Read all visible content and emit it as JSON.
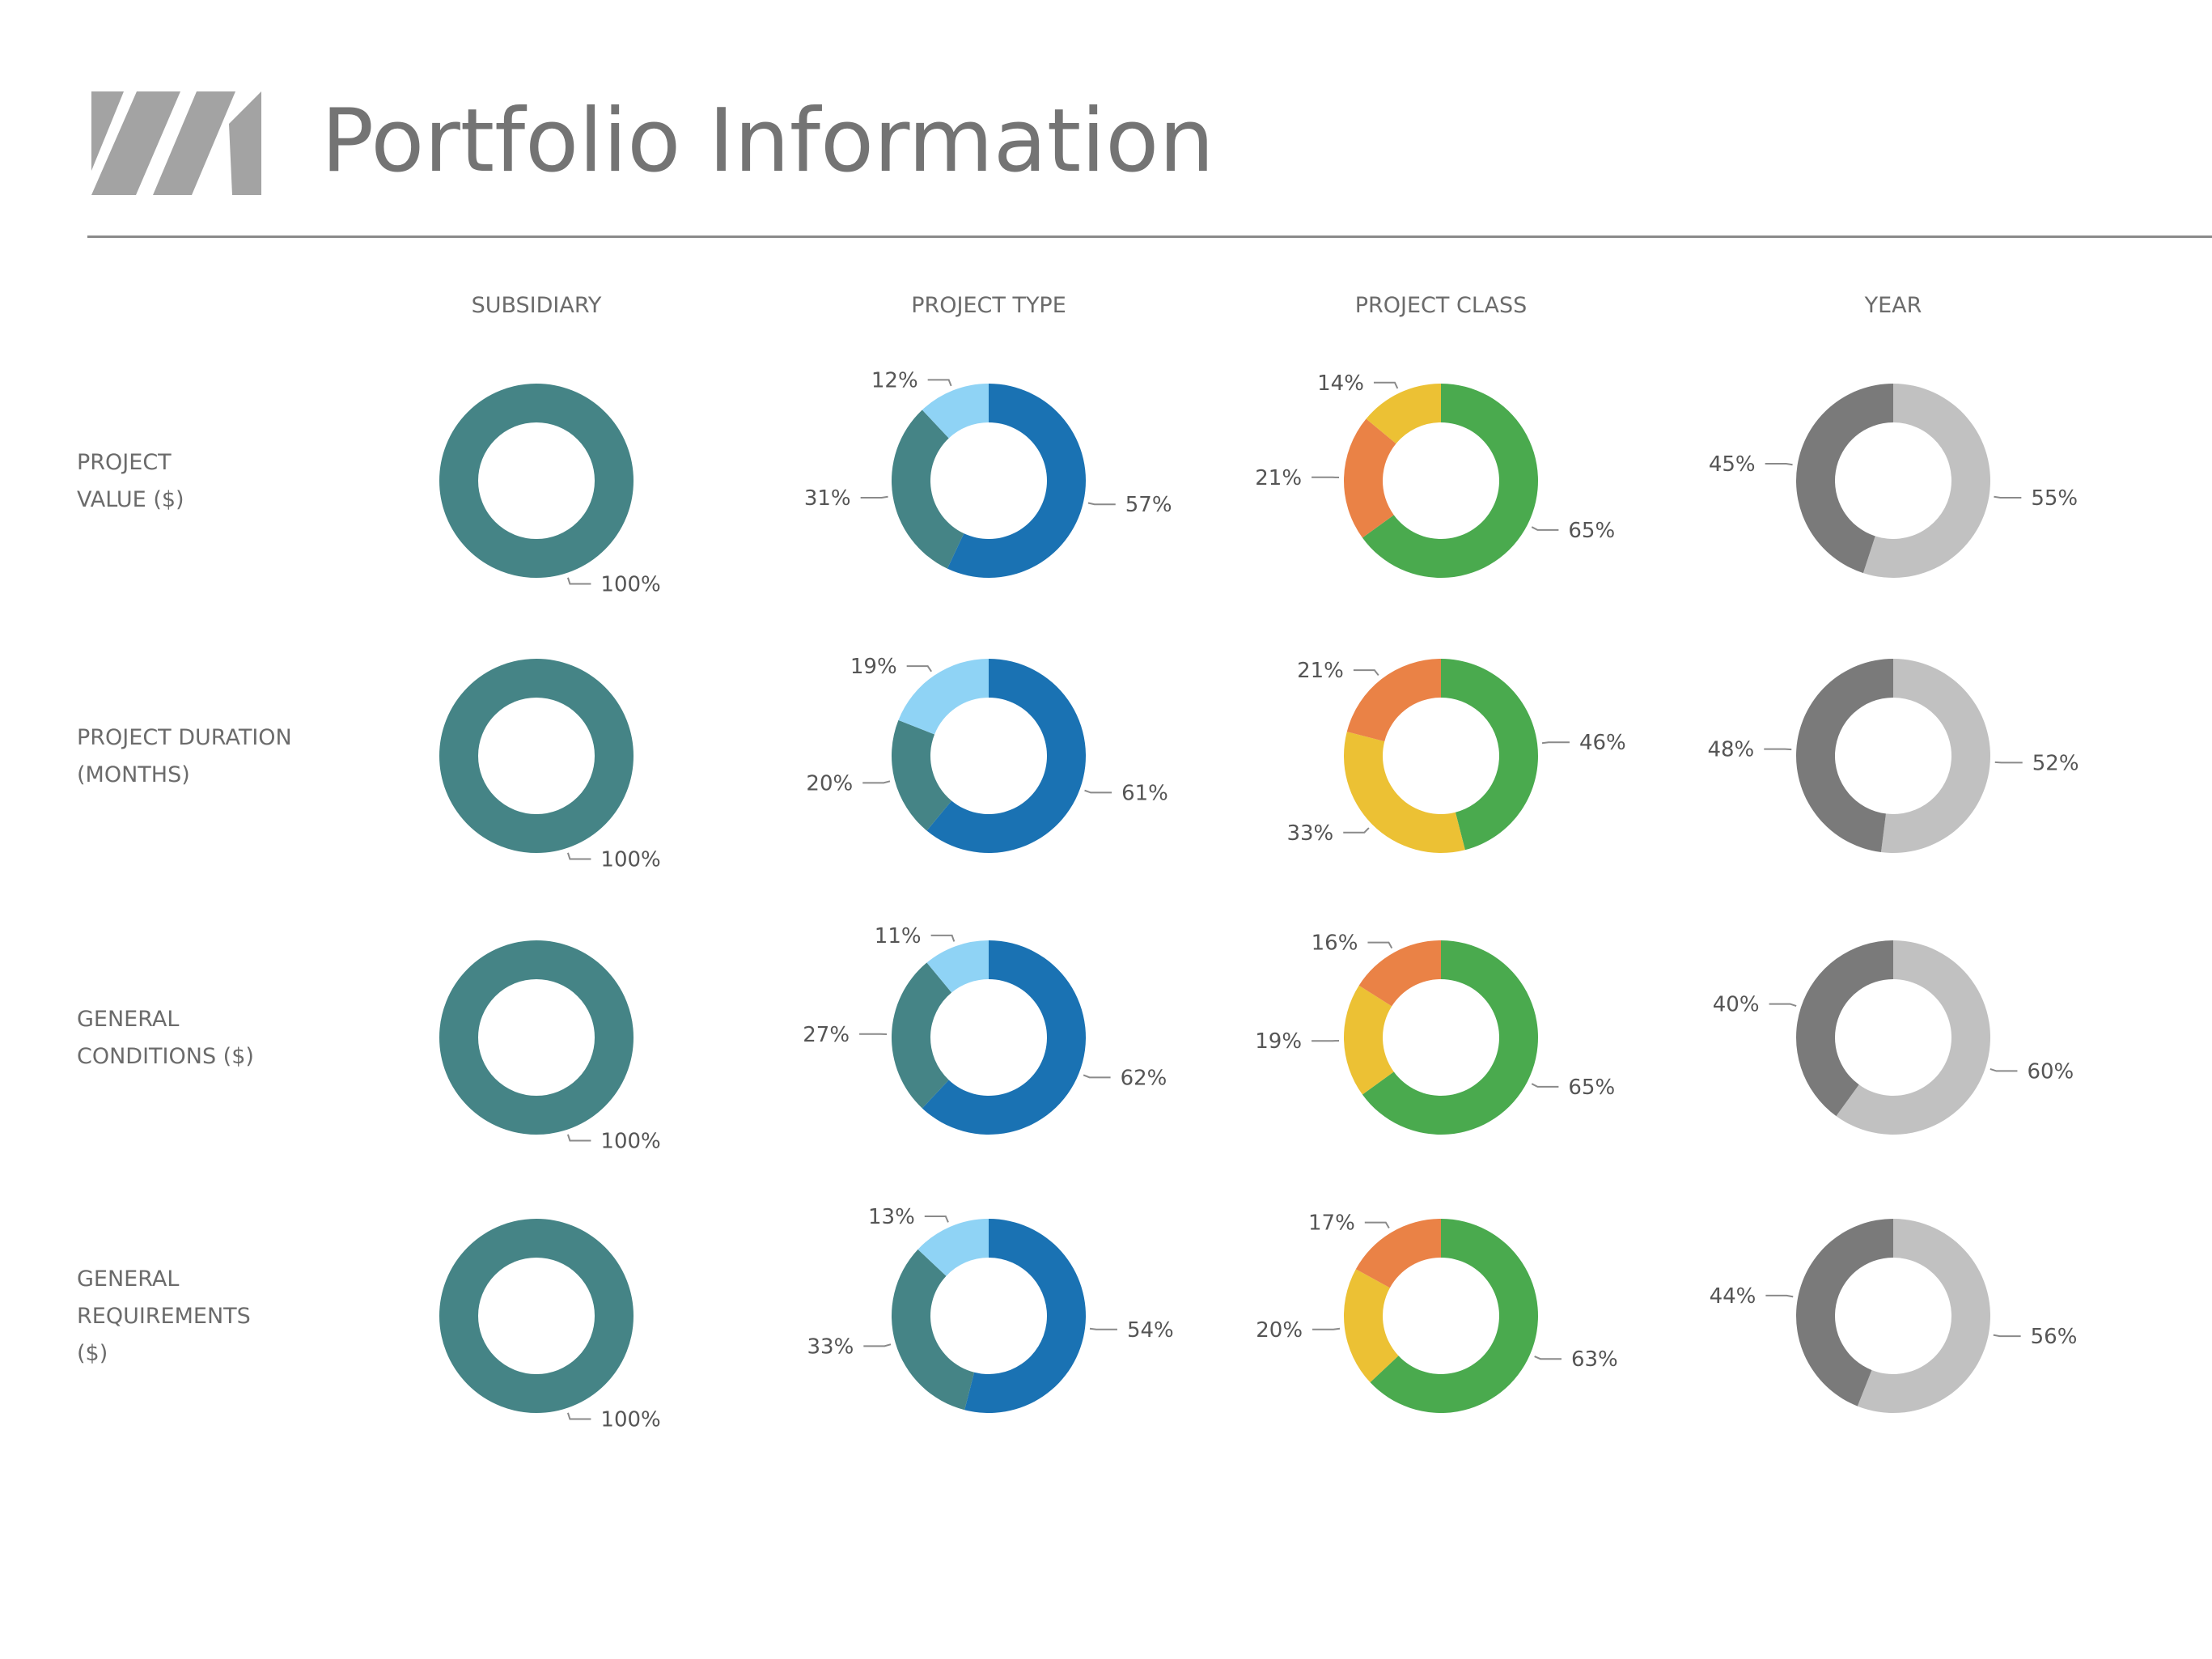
{
  "header": {
    "title": "Portfolio Information",
    "logo_color": "#a3a3a3"
  },
  "chart_data": {
    "type": "pie",
    "style": "donut-grid",
    "columns": [
      "SUBSIDIARY",
      "PROJECT TYPE",
      "PROJECT CLASS",
      "YEAR"
    ],
    "rows": [
      [
        "PROJECT",
        "VALUE ($)"
      ],
      [
        "PROJECT DURATION",
        "(MONTHS)"
      ],
      [
        "GENERAL",
        "CONDITIONS ($)"
      ],
      [
        "GENERAL",
        "REQUIREMENTS",
        "($)"
      ]
    ],
    "label_placement": "outside with leader lines",
    "charts": [
      {
        "row": 0,
        "column": 0,
        "values": [
          100
        ],
        "labels": [
          "100%"
        ],
        "colors": [
          "#458486"
        ]
      },
      {
        "row": 0,
        "column": 1,
        "values": [
          57,
          31,
          12
        ],
        "labels": [
          "57%",
          "31%",
          "12%"
        ],
        "colors": [
          "#1a72b3",
          "#458486",
          "#8fd3f5"
        ]
      },
      {
        "row": 0,
        "column": 2,
        "values": [
          65,
          21,
          14
        ],
        "labels": [
          "65%",
          "21%",
          "14%"
        ],
        "colors": [
          "#4aaa4e",
          "#ea8246",
          "#ecc134"
        ]
      },
      {
        "row": 0,
        "column": 3,
        "values": [
          55,
          45
        ],
        "labels": [
          "55%",
          "45%"
        ],
        "colors": [
          "#c1c1c1",
          "#7a7a7a"
        ]
      },
      {
        "row": 1,
        "column": 0,
        "values": [
          100
        ],
        "labels": [
          "100%"
        ],
        "colors": [
          "#458486"
        ]
      },
      {
        "row": 1,
        "column": 1,
        "values": [
          61,
          20,
          19
        ],
        "labels": [
          "61%",
          "20%",
          "19%"
        ],
        "colors": [
          "#1a72b3",
          "#458486",
          "#8fd3f5"
        ]
      },
      {
        "row": 1,
        "column": 2,
        "values": [
          46,
          33,
          21
        ],
        "labels": [
          "46%",
          "33%",
          "21%"
        ],
        "colors": [
          "#4aaa4e",
          "#ecc134",
          "#ea8246"
        ]
      },
      {
        "row": 1,
        "column": 3,
        "values": [
          52,
          48
        ],
        "labels": [
          "52%",
          "48%"
        ],
        "colors": [
          "#c1c1c1",
          "#7a7a7a"
        ]
      },
      {
        "row": 2,
        "column": 0,
        "values": [
          100
        ],
        "labels": [
          "100%"
        ],
        "colors": [
          "#458486"
        ]
      },
      {
        "row": 2,
        "column": 1,
        "values": [
          62,
          27,
          11
        ],
        "labels": [
          "62%",
          "27%",
          "11%"
        ],
        "colors": [
          "#1a72b3",
          "#458486",
          "#8fd3f5"
        ]
      },
      {
        "row": 2,
        "column": 2,
        "values": [
          65,
          19,
          16
        ],
        "labels": [
          "65%",
          "19%",
          "16%"
        ],
        "colors": [
          "#4aaa4e",
          "#ecc134",
          "#ea8246"
        ]
      },
      {
        "row": 2,
        "column": 3,
        "values": [
          60,
          40
        ],
        "labels": [
          "60%",
          "40%"
        ],
        "colors": [
          "#c1c1c1",
          "#7a7a7a"
        ]
      },
      {
        "row": 3,
        "column": 0,
        "values": [
          100
        ],
        "labels": [
          "100%"
        ],
        "colors": [
          "#458486"
        ]
      },
      {
        "row": 3,
        "column": 1,
        "values": [
          54,
          33,
          13
        ],
        "labels": [
          "54%",
          "33%",
          "13%"
        ],
        "colors": [
          "#1a72b3",
          "#458486",
          "#8fd3f5"
        ]
      },
      {
        "row": 3,
        "column": 2,
        "values": [
          63,
          20,
          17
        ],
        "labels": [
          "63%",
          "20%",
          "17%"
        ],
        "colors": [
          "#4aaa4e",
          "#ecc134",
          "#ea8246"
        ]
      },
      {
        "row": 3,
        "column": 3,
        "values": [
          56,
          44
        ],
        "labels": [
          "56%",
          "44%"
        ],
        "colors": [
          "#c1c1c1",
          "#7a7a7a"
        ]
      }
    ]
  }
}
